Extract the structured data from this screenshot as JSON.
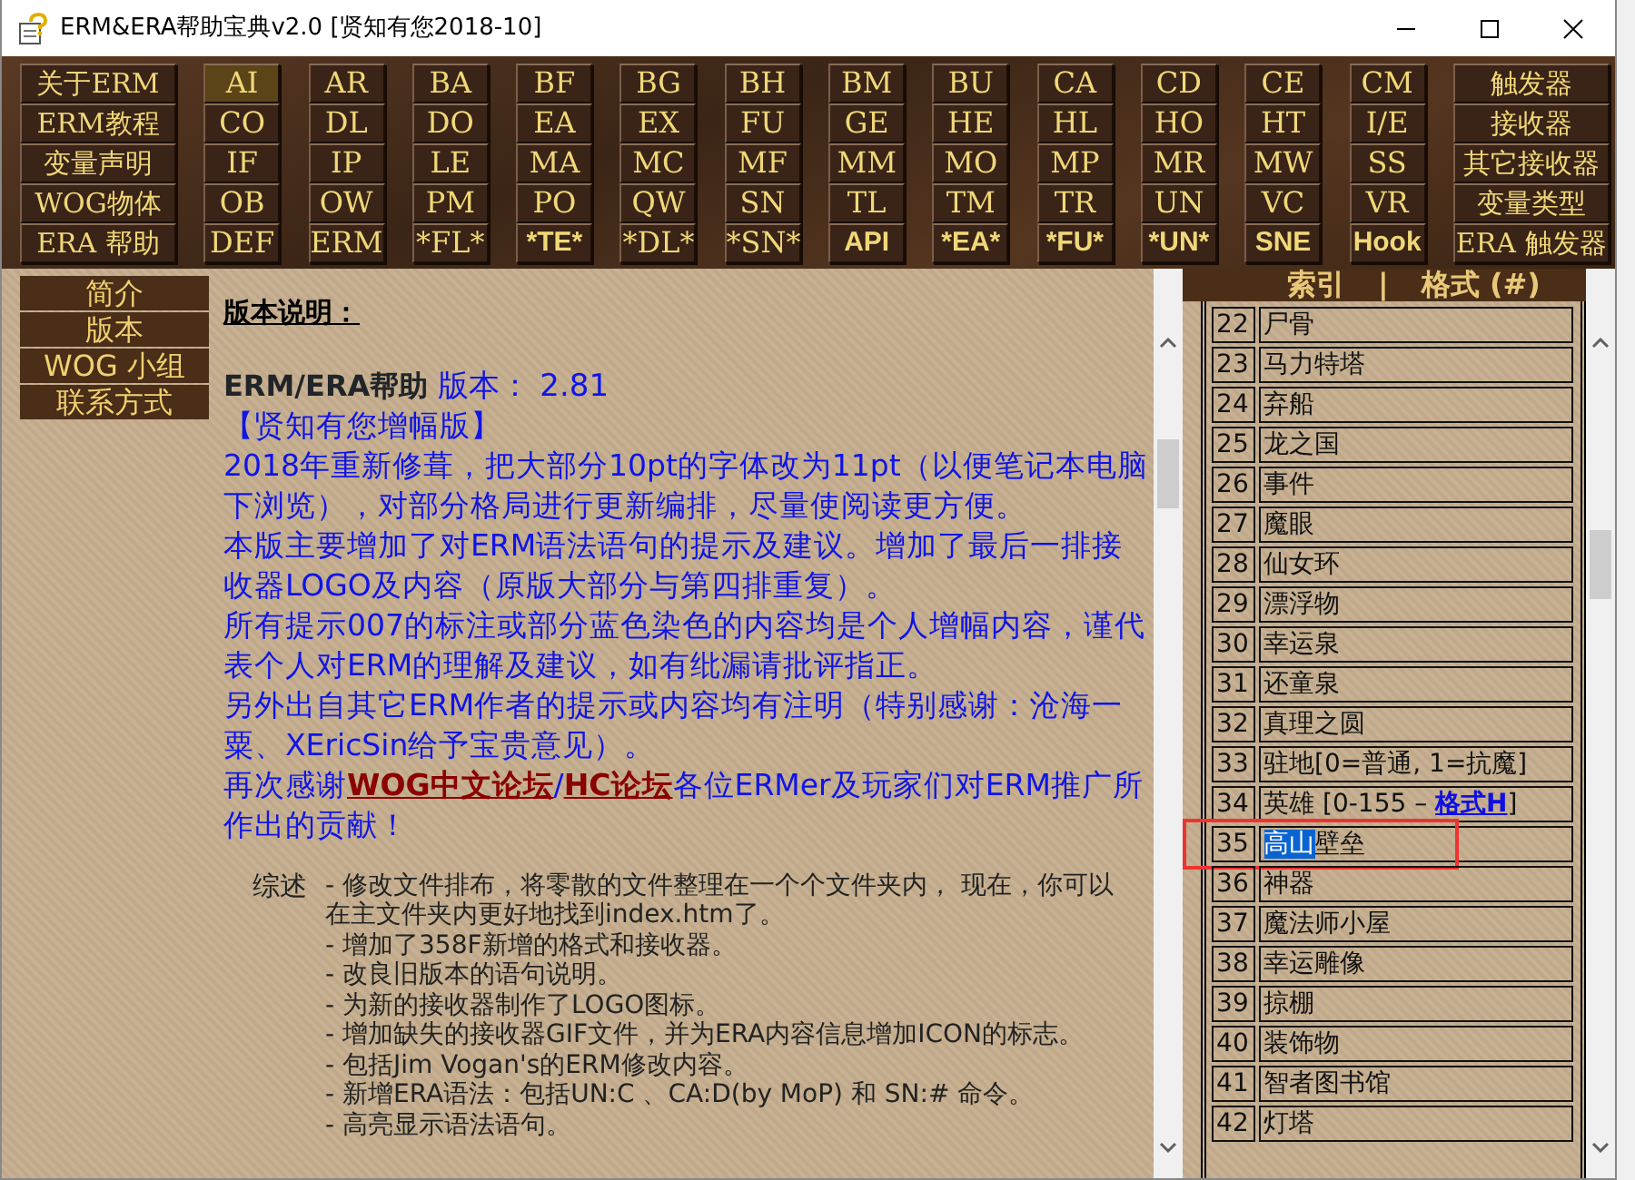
{
  "window": {
    "title": "ERM&ERA帮助宝典v2.0 [贤知有您2018-10]"
  },
  "toolbar": {
    "rows": [
      [
        {
          "label": "关于ERM",
          "highlighted": false,
          "bold": false
        },
        {
          "label": "AI",
          "highlighted": true,
          "bold": false
        },
        {
          "label": "AR",
          "highlighted": false,
          "bold": false
        },
        {
          "label": "BA",
          "highlighted": false,
          "bold": false
        },
        {
          "label": "BF",
          "highlighted": false,
          "bold": false
        },
        {
          "label": "BG",
          "highlighted": false,
          "bold": false
        },
        {
          "label": "BH",
          "highlighted": false,
          "bold": false
        },
        {
          "label": "BM",
          "highlighted": false,
          "bold": false
        },
        {
          "label": "BU",
          "highlighted": false,
          "bold": false
        },
        {
          "label": "CA",
          "highlighted": false,
          "bold": false
        },
        {
          "label": "CD",
          "highlighted": false,
          "bold": false
        },
        {
          "label": "CE",
          "highlighted": false,
          "bold": false
        },
        {
          "label": "CM",
          "highlighted": false,
          "bold": false
        },
        {
          "label": "触发器",
          "highlighted": false,
          "bold": false
        }
      ],
      [
        {
          "label": "ERM教程",
          "highlighted": false,
          "bold": false
        },
        {
          "label": "CO",
          "highlighted": false,
          "bold": false
        },
        {
          "label": "DL",
          "highlighted": false,
          "bold": false
        },
        {
          "label": "DO",
          "highlighted": false,
          "bold": false
        },
        {
          "label": "EA",
          "highlighted": false,
          "bold": false
        },
        {
          "label": "EX",
          "highlighted": false,
          "bold": false
        },
        {
          "label": "FU",
          "highlighted": false,
          "bold": false
        },
        {
          "label": "GE",
          "highlighted": false,
          "bold": false
        },
        {
          "label": "HE",
          "highlighted": false,
          "bold": false
        },
        {
          "label": "HL",
          "highlighted": false,
          "bold": false
        },
        {
          "label": "HO",
          "highlighted": false,
          "bold": false
        },
        {
          "label": "HT",
          "highlighted": false,
          "bold": false
        },
        {
          "label": "I/E",
          "highlighted": false,
          "bold": false
        },
        {
          "label": "接收器",
          "highlighted": false,
          "bold": false
        }
      ],
      [
        {
          "label": "变量声明",
          "highlighted": false,
          "bold": false
        },
        {
          "label": "IF",
          "highlighted": false,
          "bold": false
        },
        {
          "label": "IP",
          "highlighted": false,
          "bold": false
        },
        {
          "label": "LE",
          "highlighted": false,
          "bold": false
        },
        {
          "label": "MA",
          "highlighted": false,
          "bold": false
        },
        {
          "label": "MC",
          "highlighted": false,
          "bold": false
        },
        {
          "label": "MF",
          "highlighted": false,
          "bold": false
        },
        {
          "label": "MM",
          "highlighted": false,
          "bold": false
        },
        {
          "label": "MO",
          "highlighted": false,
          "bold": false
        },
        {
          "label": "MP",
          "highlighted": false,
          "bold": false
        },
        {
          "label": "MR",
          "highlighted": false,
          "bold": false
        },
        {
          "label": "MW",
          "highlighted": false,
          "bold": false
        },
        {
          "label": "SS",
          "highlighted": false,
          "bold": false
        },
        {
          "label": "其它接收器",
          "highlighted": false,
          "bold": false
        }
      ],
      [
        {
          "label": "WOG物体",
          "highlighted": false,
          "bold": false
        },
        {
          "label": "OB",
          "highlighted": false,
          "bold": false
        },
        {
          "label": "OW",
          "highlighted": false,
          "bold": false
        },
        {
          "label": "PM",
          "highlighted": false,
          "bold": false
        },
        {
          "label": "PO",
          "highlighted": false,
          "bold": false
        },
        {
          "label": "QW",
          "highlighted": false,
          "bold": false
        },
        {
          "label": "SN",
          "highlighted": false,
          "bold": false
        },
        {
          "label": "TL",
          "highlighted": false,
          "bold": false
        },
        {
          "label": "TM",
          "highlighted": false,
          "bold": false
        },
        {
          "label": "TR",
          "highlighted": false,
          "bold": false
        },
        {
          "label": "UN",
          "highlighted": false,
          "bold": false
        },
        {
          "label": "VC",
          "highlighted": false,
          "bold": false
        },
        {
          "label": "VR",
          "highlighted": false,
          "bold": false
        },
        {
          "label": "变量类型",
          "highlighted": false,
          "bold": false
        }
      ],
      [
        {
          "label": "ERA 帮助",
          "highlighted": false,
          "bold": false
        },
        {
          "label": "DEF",
          "highlighted": false,
          "bold": false
        },
        {
          "label": "ERM",
          "highlighted": false,
          "bold": false
        },
        {
          "label": "*FL*",
          "highlighted": false,
          "bold": false
        },
        {
          "label": "*TE*",
          "highlighted": false,
          "bold": true
        },
        {
          "label": "*DL*",
          "highlighted": false,
          "bold": false
        },
        {
          "label": "*SN*",
          "highlighted": false,
          "bold": false
        },
        {
          "label": "API",
          "highlighted": false,
          "bold": true
        },
        {
          "label": "*EA*",
          "highlighted": false,
          "bold": true
        },
        {
          "label": "*FU*",
          "highlighted": false,
          "bold": true
        },
        {
          "label": "*UN*",
          "highlighted": false,
          "bold": true
        },
        {
          "label": "SNE",
          "highlighted": false,
          "bold": true
        },
        {
          "label": "Hook",
          "highlighted": false,
          "bold": true
        },
        {
          "label": "ERA 触发器",
          "highlighted": false,
          "bold": false
        }
      ]
    ]
  },
  "side_nav": [
    {
      "label": "简介"
    },
    {
      "label": "版本"
    },
    {
      "label": "WOG 小组"
    },
    {
      "label": "联系方式"
    }
  ],
  "content": {
    "heading": "版本说明：",
    "product": "ERM/ERA帮助",
    "version": "版本： 2.81",
    "edition": "【贤知有您增幅版】",
    "paragraphs": [
      "2018年重新修葺，把大部分10pt的字体改为11pt（以便笔记本电脑下浏览），对部分格局进行更新编排，尽量使阅读更方便。",
      "本版主要增加了对ERM语法语句的提示及建议。增加了最后一排接收器LOGO及内容（原版大部分与第四排重复）。",
      "所有提示007的标注或部分蓝色染色的内容均是个人增幅内容，谨代表个人对ERM的理解及建议，如有纰漏请批评指正。",
      "另外出自其它ERM作者的提示或内容均有注明（特别感谢：沧海一粟、XEricSin给予宝贵意见）。"
    ],
    "thanks": {
      "before": "再次感谢",
      "links": [
        "WOG中文论坛",
        "HC论坛"
      ],
      "separator": "/",
      "after": "各位ERMer及玩家们对ERM推广所作出的贡献！"
    },
    "summary": {
      "label": "综述",
      "items": [
        "- 修改文件排布，将零散的文件整理在一个个文件夹内， 现在，你可以在主文件夹内更好地找到index.htm了。",
        "- 增加了358F新增的格式和接收器。",
        "- 改良旧版本的语句说明。",
        "- 为新的接收器制作了LOGO图标。",
        "- 增加缺失的接收器GIF文件，并为ERA内容信息增加ICON的标志。",
        "- 包括Jim Vogan's的ERM修改内容。",
        "- 新增ERA语法：包括UN:C 、CA:D(by MoP) 和 SN:# 命令。",
        "- 高亮显示语法语句。"
      ]
    }
  },
  "index_panel": {
    "header": [
      "索引",
      "|",
      "格式 (#)"
    ],
    "rows": [
      {
        "number": "22",
        "name": "尸骨",
        "marked": false
      },
      {
        "number": "23",
        "name": "马力特塔",
        "marked": false
      },
      {
        "number": "24",
        "name": "弃船",
        "marked": false
      },
      {
        "number": "25",
        "name": "龙之国",
        "marked": false
      },
      {
        "number": "26",
        "name": "事件",
        "marked": false
      },
      {
        "number": "27",
        "name": "魔眼",
        "marked": false
      },
      {
        "number": "28",
        "name": "仙女环",
        "marked": false
      },
      {
        "number": "29",
        "name": "漂浮物",
        "marked": false
      },
      {
        "number": "30",
        "name": "幸运泉",
        "marked": false
      },
      {
        "number": "31",
        "name": "还童泉",
        "marked": false
      },
      {
        "number": "32",
        "name": "真理之圆",
        "marked": false
      },
      {
        "number": "33",
        "name": "驻地[0=普通, 1=抗魔]",
        "marked": false
      },
      {
        "number": "34",
        "name": "英雄 [0-155 –",
        "link": "格式H",
        "suffix": "]",
        "marked": false
      },
      {
        "number": "35",
        "selection": "高山",
        "name": "壁垒",
        "marked": true
      },
      {
        "number": "36",
        "name": "神器",
        "marked": false
      },
      {
        "number": "37",
        "name": "魔法师小屋",
        "marked": false
      },
      {
        "number": "38",
        "name": "幸运雕像",
        "marked": false
      },
      {
        "number": "39",
        "name": "掠棚",
        "marked": false
      },
      {
        "number": "40",
        "name": "装饰物",
        "marked": false
      },
      {
        "number": "41",
        "name": "智者图书馆",
        "marked": false
      },
      {
        "number": "42",
        "name": "灯塔",
        "marked": false
      }
    ]
  }
}
